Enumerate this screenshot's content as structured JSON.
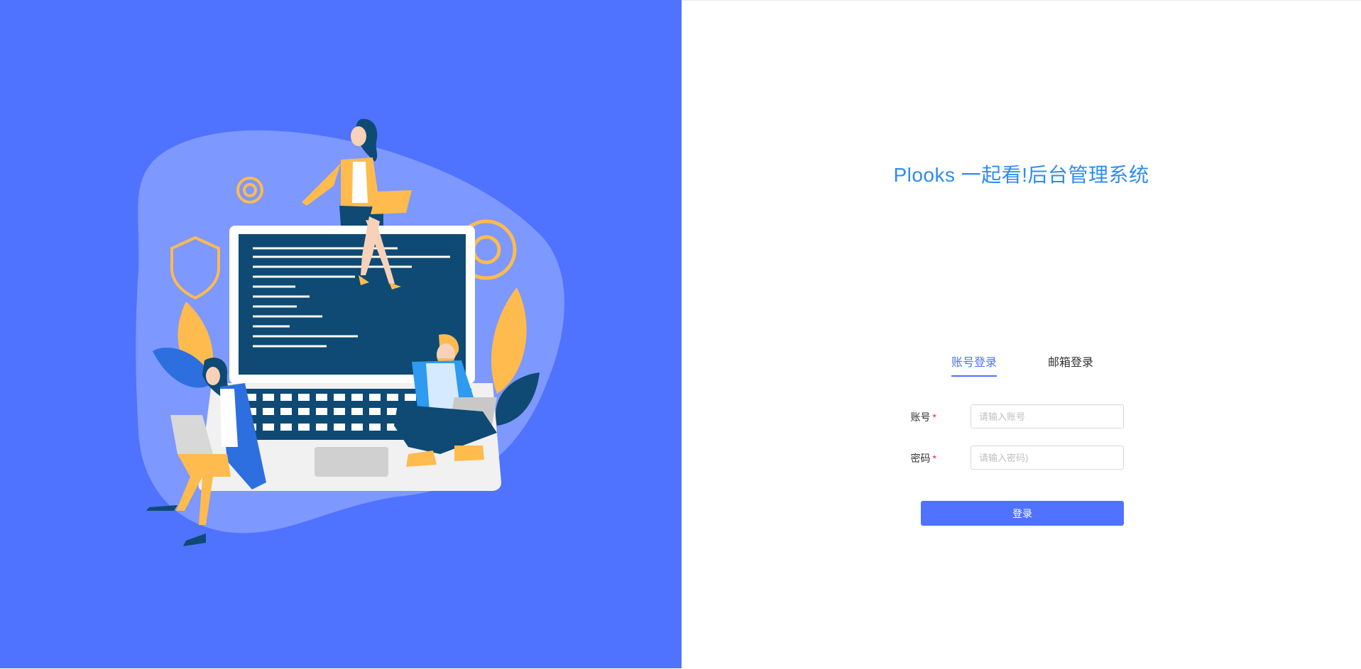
{
  "app": {
    "title": "Plooks 一起看!后台管理系统"
  },
  "login": {
    "tabs": [
      {
        "label": "账号登录",
        "active": true
      },
      {
        "label": "邮箱登录",
        "active": false
      }
    ],
    "account": {
      "label": "账号",
      "required_mark": "*",
      "placeholder": "请输入账号",
      "value": ""
    },
    "password": {
      "label": "密码",
      "required_mark": "*",
      "placeholder": "请输入密码)",
      "value": ""
    },
    "submit_label": "登录"
  },
  "theme": {
    "primary": "#4f72ff",
    "title_color": "#2d8cf0",
    "blob": "#7d98ff",
    "dark_navy": "#0e4a73",
    "accent_orange": "#ffbb4d"
  },
  "illustration": {
    "name": "people-with-laptop-illustration"
  }
}
